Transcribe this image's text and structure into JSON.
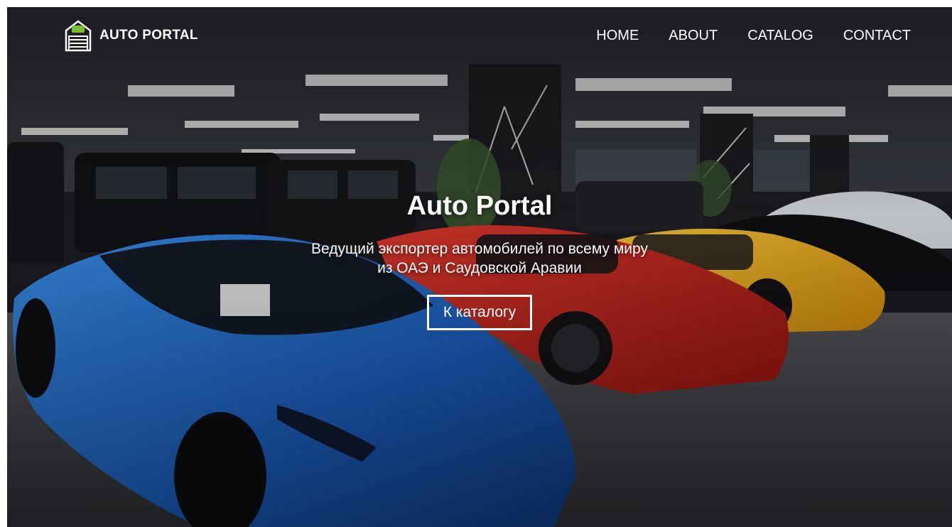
{
  "navbar": {
    "brand_name": "AUTO PORTAL",
    "brand_icon": "garage-icon",
    "links": [
      {
        "label": "HOME"
      },
      {
        "label": "ABOUT"
      },
      {
        "label": "CATALOG"
      },
      {
        "label": "CONTACT"
      }
    ]
  },
  "hero": {
    "title": "Auto Portal",
    "subtitle": "Ведущий экспортер автомобилей по всему миру из ОАЭ и Саудовской Аравии",
    "cta_label": "К каталогу"
  },
  "colors": {
    "text": "#ffffff",
    "overlay": "#000000",
    "car_blue": "#1f6fd1",
    "car_red": "#c8231f",
    "car_yellow": "#f2b11c"
  }
}
